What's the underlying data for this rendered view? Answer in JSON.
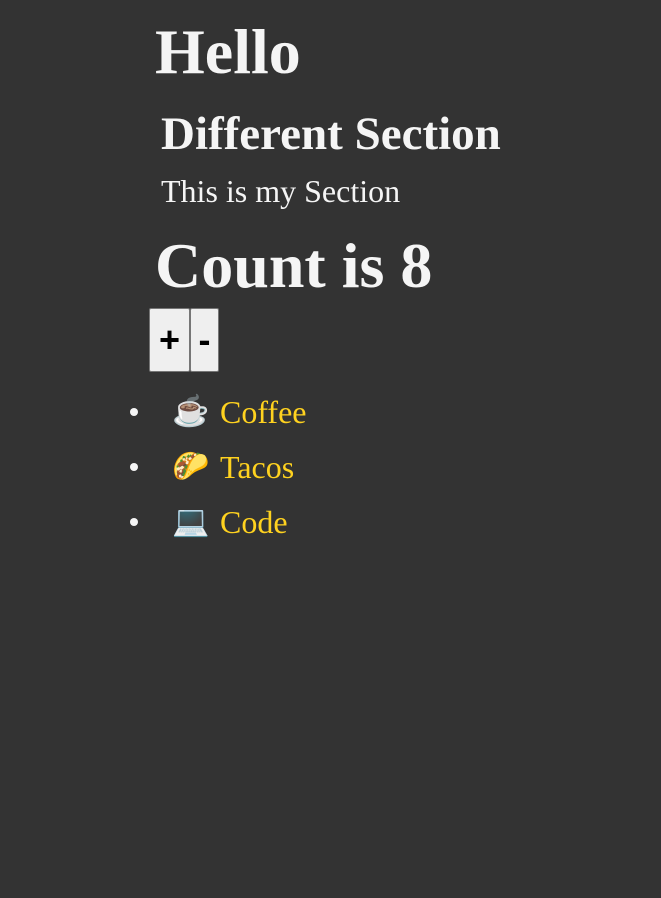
{
  "heading": "Hello",
  "section": {
    "title": "Different Section",
    "text": "This is my Section"
  },
  "counter": {
    "label": "Count is 8",
    "increment_label": "+",
    "decrement_label": "-"
  },
  "items": [
    {
      "icon": "☕",
      "icon_name": "coffee-icon",
      "label": "Coffee"
    },
    {
      "icon": "🌮",
      "icon_name": "taco-icon",
      "label": "Tacos"
    },
    {
      "icon": "💻",
      "icon_name": "laptop-icon",
      "label": "Code"
    }
  ],
  "colors": {
    "background": "#333333",
    "text": "#f5f5f5",
    "link": "#ffd21f"
  }
}
